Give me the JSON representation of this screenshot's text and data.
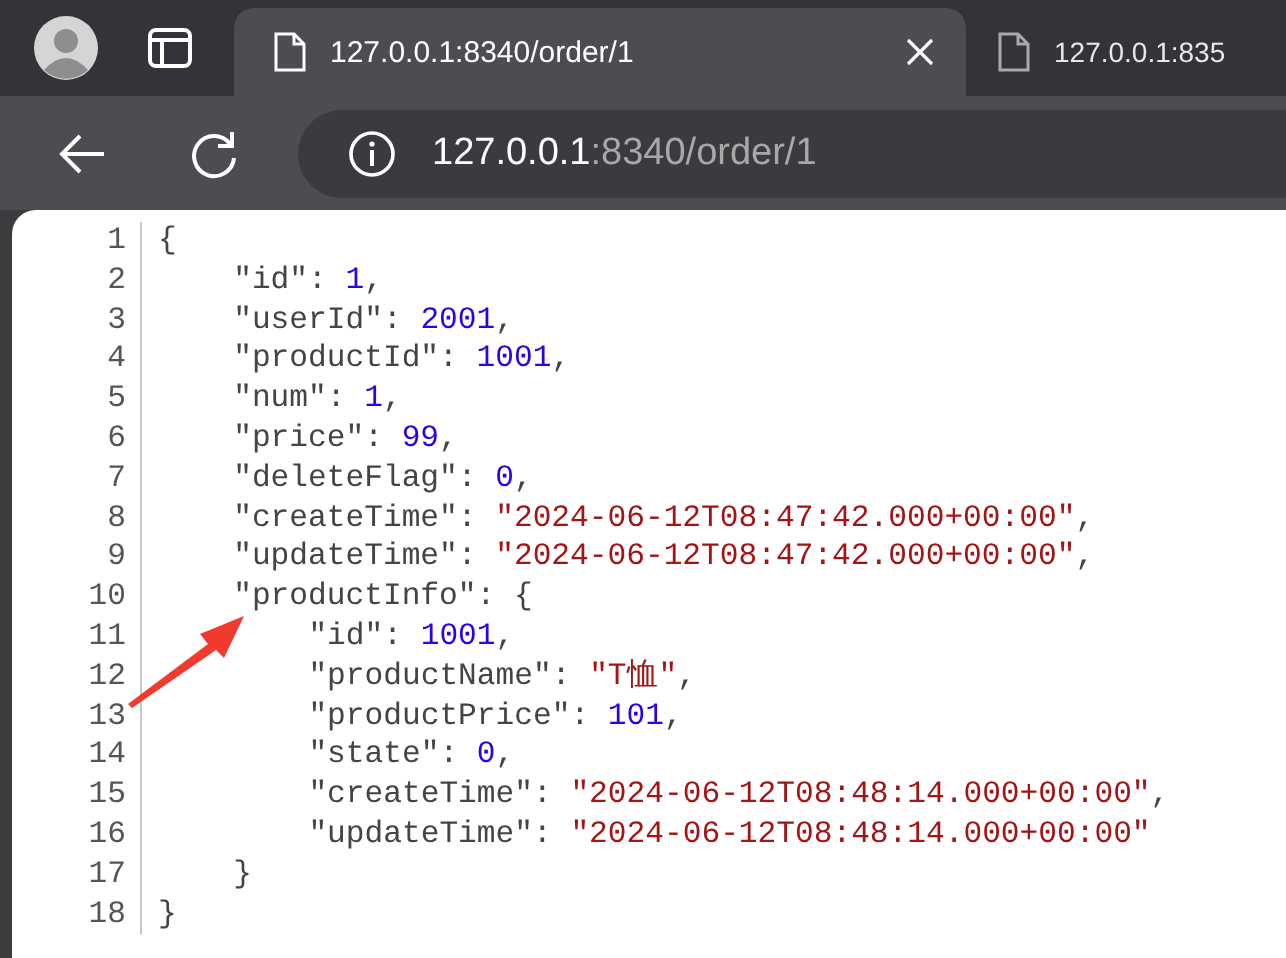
{
  "browser": {
    "tabs": [
      {
        "title": "127.0.0.1:8340/order/1",
        "selected": true
      },
      {
        "title": "127.0.0.1:835",
        "selected": false
      }
    ],
    "address_bar": {
      "host": "127.0.0.1",
      "rest": ":8340/order/1"
    }
  },
  "document": {
    "lines": [
      {
        "number": "1",
        "tokens": [
          {
            "kind": "punct",
            "text": "{"
          }
        ],
        "children": [
          {
            "number": "2",
            "tokens": [
              {
                "kind": "key",
                "text": "\"id\""
              },
              {
                "kind": "punct",
                "text": ": "
              },
              {
                "kind": "number",
                "text": "1"
              },
              {
                "kind": "punct",
                "text": ","
              }
            ]
          },
          {
            "number": "3",
            "tokens": [
              {
                "kind": "key",
                "text": "\"userId\""
              },
              {
                "kind": "punct",
                "text": ": "
              },
              {
                "kind": "number",
                "text": "2001"
              },
              {
                "kind": "punct",
                "text": ","
              }
            ]
          },
          {
            "number": "4",
            "tokens": [
              {
                "kind": "key",
                "text": "\"productId\""
              },
              {
                "kind": "punct",
                "text": ": "
              },
              {
                "kind": "number",
                "text": "1001"
              },
              {
                "kind": "punct",
                "text": ","
              }
            ]
          },
          {
            "number": "5",
            "tokens": [
              {
                "kind": "key",
                "text": "\"num\""
              },
              {
                "kind": "punct",
                "text": ": "
              },
              {
                "kind": "number",
                "text": "1"
              },
              {
                "kind": "punct",
                "text": ","
              }
            ]
          },
          {
            "number": "6",
            "tokens": [
              {
                "kind": "key",
                "text": "\"price\""
              },
              {
                "kind": "punct",
                "text": ": "
              },
              {
                "kind": "number",
                "text": "99"
              },
              {
                "kind": "punct",
                "text": ","
              }
            ]
          },
          {
            "number": "7",
            "tokens": [
              {
                "kind": "key",
                "text": "\"deleteFlag\""
              },
              {
                "kind": "punct",
                "text": ": "
              },
              {
                "kind": "number",
                "text": "0"
              },
              {
                "kind": "punct",
                "text": ","
              }
            ]
          },
          {
            "number": "8",
            "tokens": [
              {
                "kind": "key",
                "text": "\"createTime\""
              },
              {
                "kind": "punct",
                "text": ": "
              },
              {
                "kind": "string",
                "text": "\"2024-06-12T08:47:42.000+00:00\""
              },
              {
                "kind": "punct",
                "text": ","
              }
            ]
          },
          {
            "number": "9",
            "tokens": [
              {
                "kind": "key",
                "text": "\"updateTime\""
              },
              {
                "kind": "punct",
                "text": ": "
              },
              {
                "kind": "string",
                "text": "\"2024-06-12T08:47:42.000+00:00\""
              },
              {
                "kind": "punct",
                "text": ","
              }
            ]
          },
          {
            "number": "10",
            "tokens": [
              {
                "kind": "key",
                "text": "\"productInfo\""
              },
              {
                "kind": "punct",
                "text": ": {"
              }
            ],
            "children": [
              {
                "number": "11",
                "tokens": [
                  {
                    "kind": "key",
                    "text": "\"id\""
                  },
                  {
                    "kind": "punct",
                    "text": ": "
                  },
                  {
                    "kind": "number",
                    "text": "1001"
                  },
                  {
                    "kind": "punct",
                    "text": ","
                  }
                ]
              },
              {
                "number": "12",
                "tokens": [
                  {
                    "kind": "key",
                    "text": "\"productName\""
                  },
                  {
                    "kind": "punct",
                    "text": ": "
                  },
                  {
                    "kind": "string",
                    "text": "\"T恤\""
                  },
                  {
                    "kind": "punct",
                    "text": ","
                  }
                ]
              },
              {
                "number": "13",
                "tokens": [
                  {
                    "kind": "key",
                    "text": "\"productPrice\""
                  },
                  {
                    "kind": "punct",
                    "text": ": "
                  },
                  {
                    "kind": "number",
                    "text": "101"
                  },
                  {
                    "kind": "punct",
                    "text": ","
                  }
                ]
              },
              {
                "number": "14",
                "tokens": [
                  {
                    "kind": "key",
                    "text": "\"state\""
                  },
                  {
                    "kind": "punct",
                    "text": ": "
                  },
                  {
                    "kind": "number",
                    "text": "0"
                  },
                  {
                    "kind": "punct",
                    "text": ","
                  }
                ]
              },
              {
                "number": "15",
                "tokens": [
                  {
                    "kind": "key",
                    "text": "\"createTime\""
                  },
                  {
                    "kind": "punct",
                    "text": ": "
                  },
                  {
                    "kind": "string",
                    "text": "\"2024-06-12T08:48:14.000+00:00\""
                  },
                  {
                    "kind": "punct",
                    "text": ","
                  }
                ]
              },
              {
                "number": "16",
                "tokens": [
                  {
                    "kind": "key",
                    "text": "\"updateTime\""
                  },
                  {
                    "kind": "punct",
                    "text": ": "
                  },
                  {
                    "kind": "string",
                    "text": "\"2024-06-12T08:48:14.000+00:00\""
                  }
                ]
              }
            ]
          },
          {
            "number": "17",
            "tokens": [
              {
                "kind": "punct",
                "text": "}"
              }
            ]
          }
        ]
      },
      {
        "number": "18",
        "tokens": [
          {
            "kind": "punct",
            "text": "}"
          }
        ]
      }
    ]
  }
}
